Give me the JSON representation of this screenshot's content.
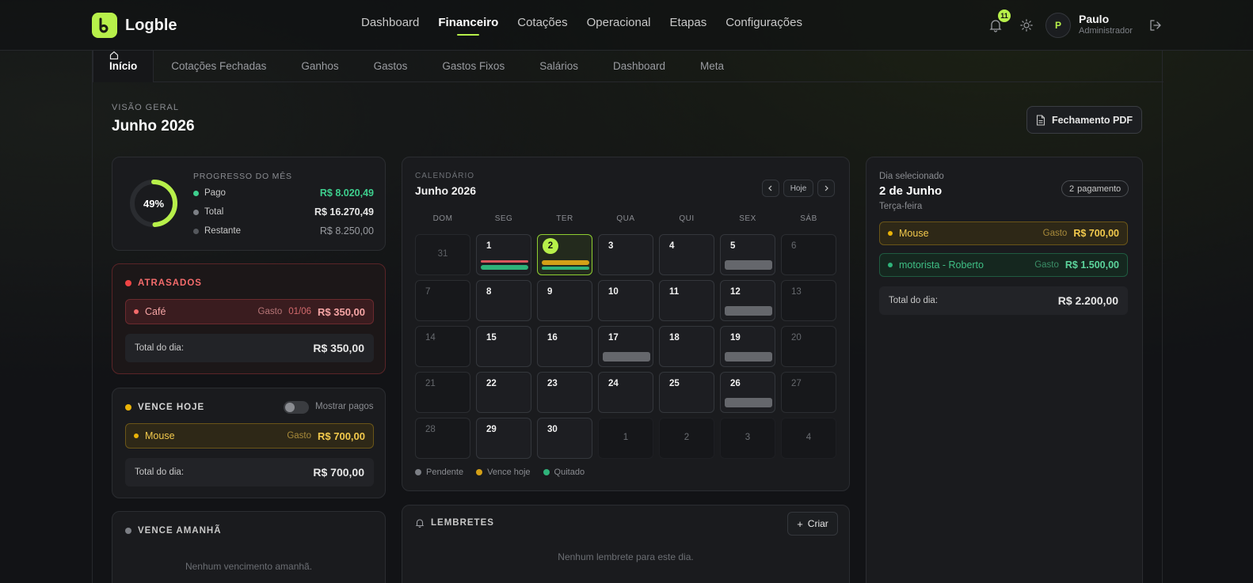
{
  "app": {
    "name": "Logble"
  },
  "nav": {
    "items": [
      {
        "label": "Dashboard"
      },
      {
        "label": "Financeiro"
      },
      {
        "label": "Cotações"
      },
      {
        "label": "Operacional"
      },
      {
        "label": "Etapas"
      },
      {
        "label": "Configurações"
      }
    ],
    "active": "Financeiro"
  },
  "notifications": {
    "count": "11"
  },
  "user": {
    "initial": "P",
    "name": "Paulo",
    "role": "Administrador"
  },
  "subnav": {
    "tabs": [
      {
        "label": "Início"
      },
      {
        "label": "Cotações Fechadas"
      },
      {
        "label": "Ganhos"
      },
      {
        "label": "Gastos"
      },
      {
        "label": "Gastos Fixos"
      },
      {
        "label": "Salários"
      },
      {
        "label": "Dashboard"
      },
      {
        "label": "Meta"
      }
    ],
    "active": "Início"
  },
  "overview": {
    "label": "VISÃO GERAL",
    "title": "Junho 2026",
    "pdf_button": "Fechamento PDF"
  },
  "progress": {
    "title": "PROGRESSO DO MÊS",
    "percent_label": "49%",
    "percent_value": 0.49,
    "rows": [
      {
        "label": "Pago",
        "value": "R$ 8.020,49",
        "color": "#3ecf8e"
      },
      {
        "label": "Total",
        "value": "R$ 16.270,49",
        "color": "#7c7f85"
      },
      {
        "label": "Restante",
        "value": "R$ 8.250,00",
        "color": "#55585d"
      }
    ],
    "ring_color": "#b7f04a"
  },
  "overdue": {
    "title": "ATRASADOS",
    "color": "#ef4444",
    "entries": [
      {
        "name": "Café",
        "kind": "Gasto",
        "date": "01/06",
        "amount": "R$ 350,00"
      }
    ],
    "total_label": "Total do dia:",
    "total": "R$ 350,00"
  },
  "due_today": {
    "title": "VENCE HOJE",
    "color": "#eab308",
    "toggle_label": "Mostrar pagos",
    "entries": [
      {
        "name": "Mouse",
        "kind": "Gasto",
        "amount": "R$ 700,00"
      }
    ],
    "total_label": "Total do dia:",
    "total": "R$ 700,00"
  },
  "due_tomorrow": {
    "title": "VENCE AMANHÃ",
    "empty": "Nenhum vencimento amanhã."
  },
  "calendar": {
    "label": "CALENDÁRIO",
    "title": "Junho 2026",
    "today_button": "Hoje",
    "weekdays": [
      "DOM",
      "SEG",
      "TER",
      "QUA",
      "QUI",
      "SEX",
      "SÁB"
    ],
    "weeks": [
      [
        "31",
        "1",
        "2",
        "3",
        "4",
        "5",
        "6"
      ],
      [
        "7",
        "8",
        "9",
        "10",
        "11",
        "12",
        "13"
      ],
      [
        "14",
        "15",
        "16",
        "17",
        "18",
        "19",
        "20"
      ],
      [
        "21",
        "22",
        "23",
        "24",
        "25",
        "26",
        "27"
      ],
      [
        "28",
        "29",
        "30",
        "1",
        "2",
        "3",
        "4"
      ]
    ],
    "selected_day": "2",
    "legend": [
      {
        "label": "Pendente",
        "color": "#7c7f85"
      },
      {
        "label": "Vence hoje",
        "color": "#d4a017"
      },
      {
        "label": "Quitado",
        "color": "#2fb37a"
      }
    ]
  },
  "reminders": {
    "title": "LEMBRETES",
    "create_button": "Criar",
    "empty": "Nenhum lembrete para este dia."
  },
  "selected": {
    "label": "Dia selecionado",
    "date": "2 de Junho",
    "weekday": "Terça-feira",
    "count": "2",
    "count_label": "pagamento",
    "entries": [
      {
        "name": "Mouse",
        "kind": "Gasto",
        "amount": "R$ 700,00",
        "status": "vence-hoje"
      },
      {
        "name": "motorista - Roberto",
        "kind": "Gasto",
        "amount": "R$ 1.500,00",
        "status": "quitado"
      }
    ],
    "total_label": "Total do dia:",
    "total": "R$ 2.200,00"
  }
}
